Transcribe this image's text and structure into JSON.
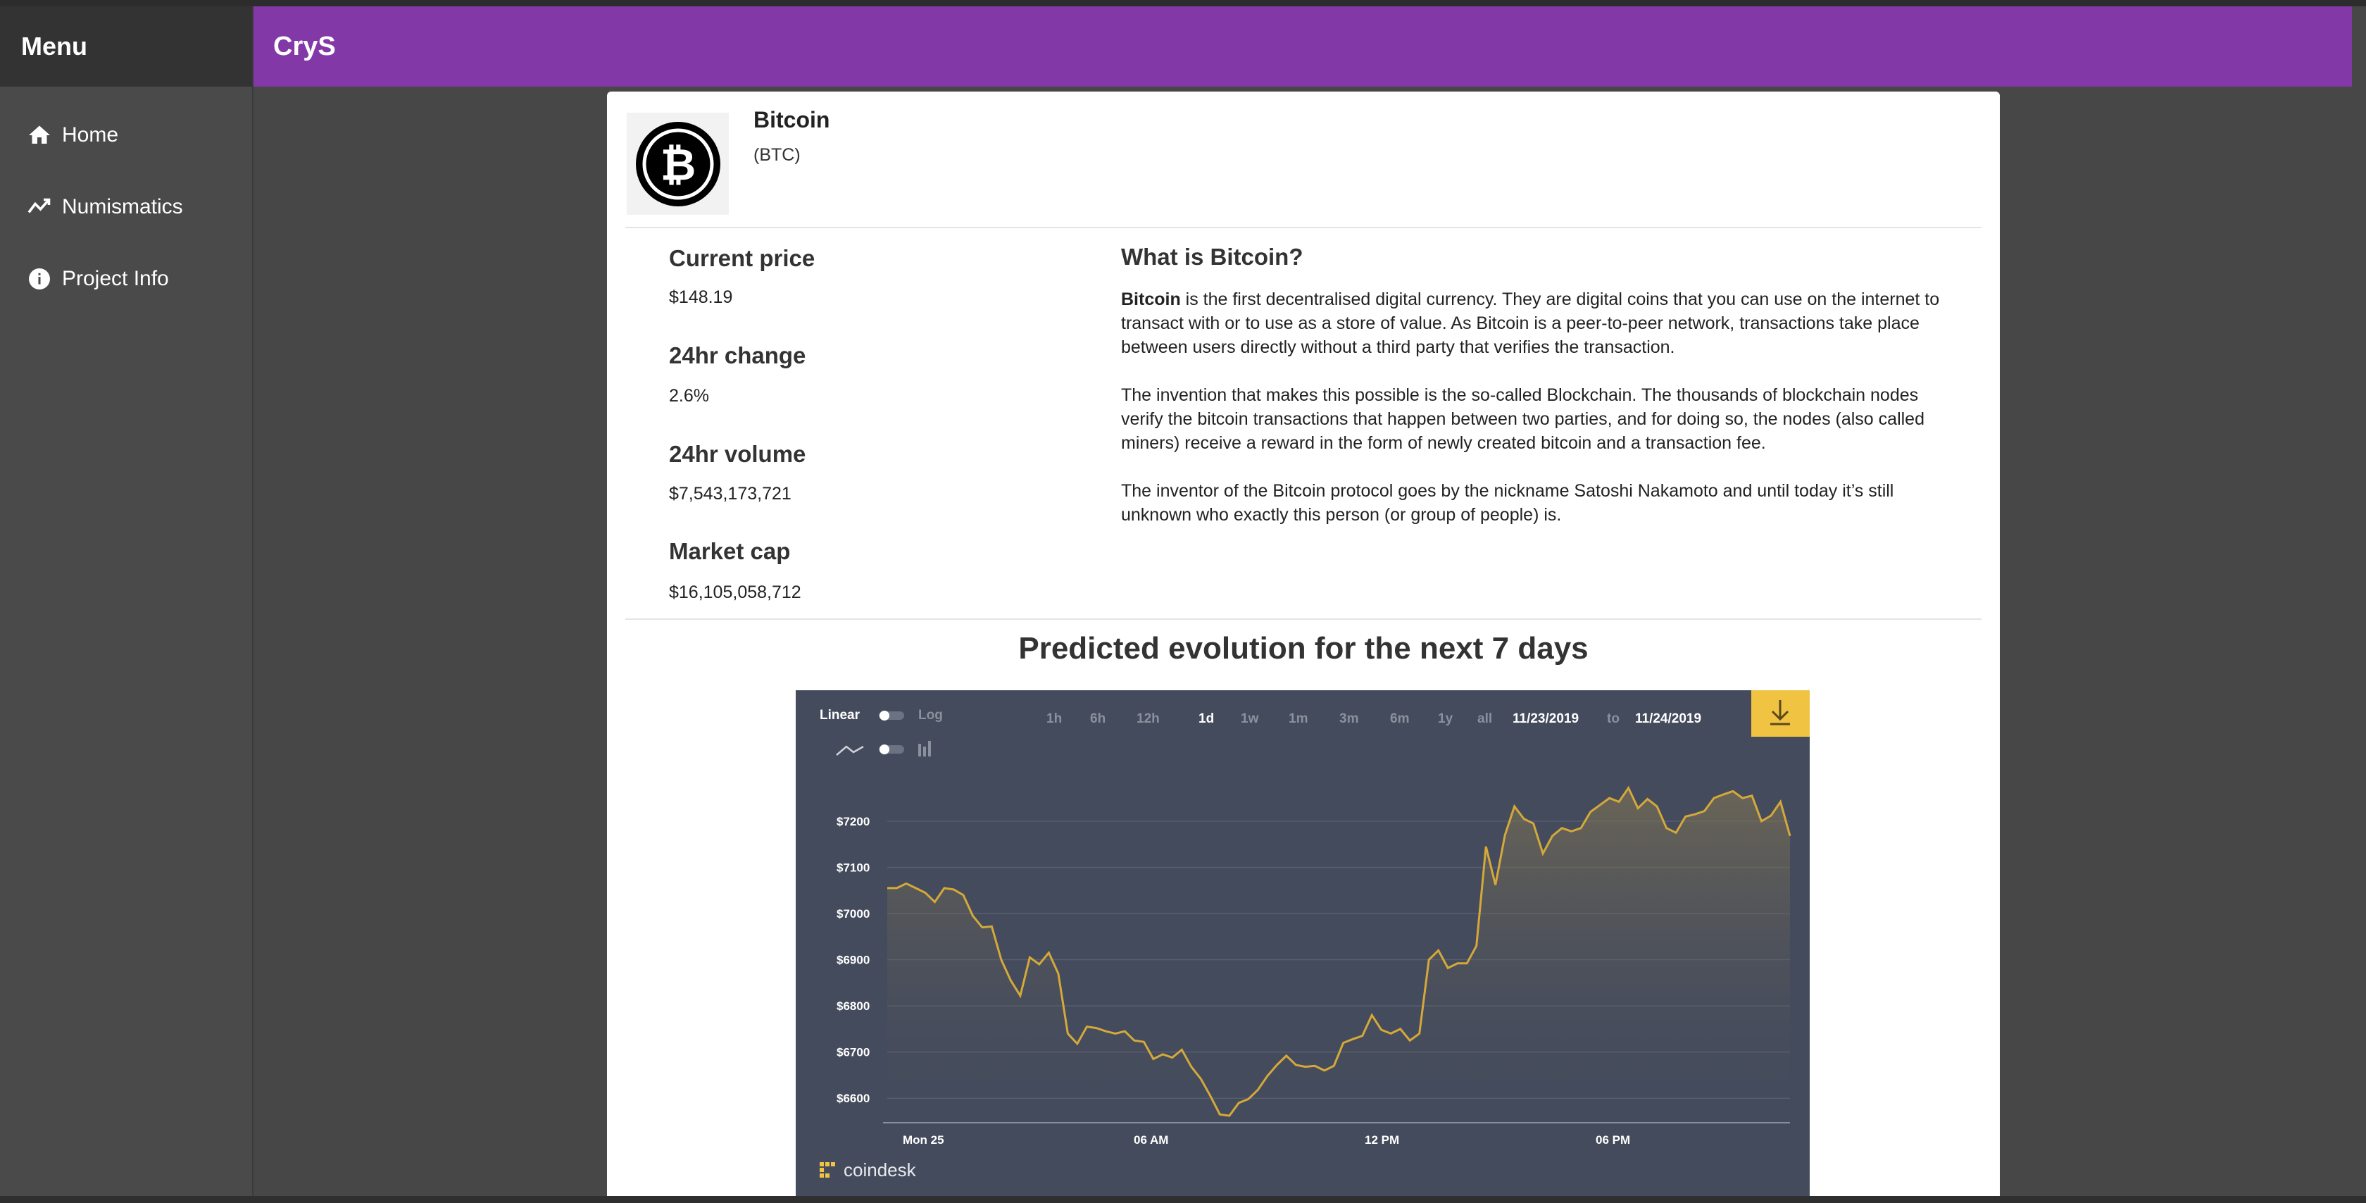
{
  "sidebar": {
    "title": "Menu",
    "items": [
      {
        "label": "Home",
        "icon": "home-icon"
      },
      {
        "label": "Numismatics",
        "icon": "trending-icon"
      },
      {
        "label": "Project Info",
        "icon": "info-icon"
      }
    ]
  },
  "header": {
    "title": "CryS"
  },
  "coin": {
    "name": "Bitcoin",
    "symbol": "(BTC)",
    "logo_icon": "bitcoin-icon"
  },
  "stats": [
    {
      "label": "Current price",
      "value": "$148.19"
    },
    {
      "label": "24hr change",
      "value": "2.6%"
    },
    {
      "label": "24hr volume",
      "value": "$7,543,173,721"
    },
    {
      "label": "Market cap",
      "value": "$16,105,058,712"
    }
  ],
  "about": {
    "title": "What is Bitcoin?",
    "p1_bold": "Bitcoin",
    "p1_rest": " is the first decentralised digital currency. They are digital coins that you can use on the internet to transact with or to use as a store of value. As Bitcoin is a peer-to-peer network, transactions take place between users directly without a third party that verifies the transaction.",
    "p2": "The invention that makes this possible is the so-called Blockchain. The thousands of blockchain nodes verify the bitcoin transactions that happen between two parties, and for doing so, the nodes (also called miners) receive a reward in the form of newly created bitcoin and a transaction fee.",
    "p3": "The inventor of the Bitcoin protocol goes by the nickname Satoshi Nakamoto and until today it’s still unknown who exactly this person (or group of people) is."
  },
  "prediction": {
    "title": "Predicted evolution for the next 7 days"
  },
  "chart_widget": {
    "scale_linear": "Linear",
    "scale_log": "Log",
    "ranges": [
      "1h",
      "6h",
      "12h",
      "1d",
      "1w",
      "1m",
      "3m",
      "6m",
      "1y",
      "all"
    ],
    "selected_range": "1d",
    "date_from": "11/23/2019",
    "date_to_label": "to",
    "date_to": "11/24/2019",
    "brand": "coindesk",
    "colors": {
      "background": "#444b5c",
      "line": "#d4a93a",
      "download_button": "#f1c342",
      "accent_text": "#ffffff"
    }
  },
  "chart_data": {
    "type": "area",
    "y_ticks": [
      "$7200",
      "$7100",
      "$7000",
      "$6900",
      "$6800",
      "$6700",
      "$6600"
    ],
    "x_ticks": [
      "Mon 25",
      "06 AM",
      "12 PM",
      "06 PM"
    ],
    "ylim": [
      6550,
      7270
    ],
    "grid": true,
    "values": [
      7055,
      7055,
      7065,
      7055,
      7045,
      7025,
      7055,
      7052,
      7040,
      6995,
      6970,
      6972,
      6900,
      6855,
      6822,
      6905,
      6890,
      6915,
      6870,
      6740,
      6718,
      6755,
      6752,
      6745,
      6740,
      6745,
      6725,
      6722,
      6685,
      6695,
      6688,
      6705,
      6668,
      6642,
      6605,
      6565,
      6562,
      6590,
      6598,
      6618,
      6648,
      6672,
      6692,
      6672,
      6668,
      6670,
      6660,
      6670,
      6720,
      6728,
      6735,
      6780,
      6748,
      6740,
      6750,
      6725,
      6740,
      6900,
      6920,
      6882,
      6892,
      6892,
      6930,
      7145,
      7062,
      7170,
      7232,
      7205,
      7195,
      7130,
      7168,
      7185,
      7178,
      7185,
      7220,
      7235,
      7250,
      7242,
      7272,
      7228,
      7248,
      7232,
      7185,
      7175,
      7210,
      7215,
      7222,
      7250,
      7258,
      7265,
      7250,
      7255,
      7200,
      7212,
      7242,
      7168
    ]
  }
}
